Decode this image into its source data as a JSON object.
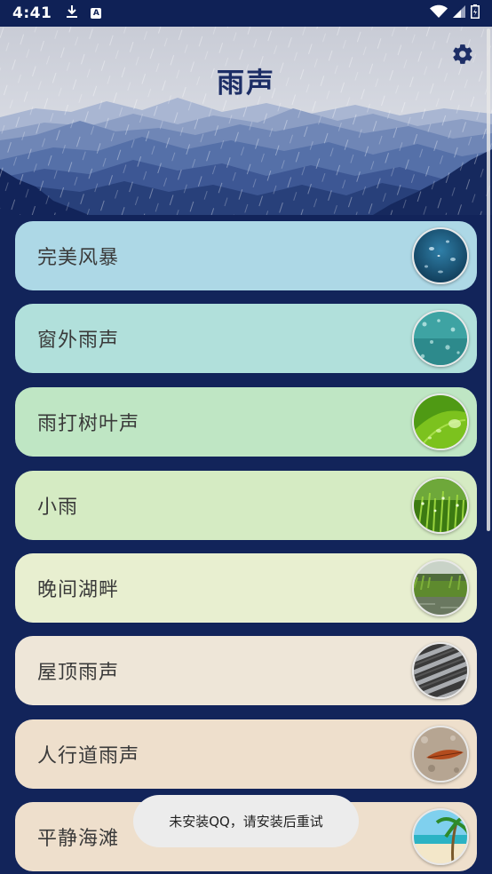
{
  "status_bar": {
    "time": "4:41"
  },
  "header": {
    "title": "雨声"
  },
  "cards": [
    {
      "label": "完美风暴",
      "color": "#add8e6",
      "thumb": "water-drops-blue"
    },
    {
      "label": "窗外雨声",
      "color": "#b1e0db",
      "thumb": "window-rain-teal"
    },
    {
      "label": "雨打树叶声",
      "color": "#bfe6c4",
      "thumb": "leaf-drops-green"
    },
    {
      "label": "小雨",
      "color": "#d5ebc3",
      "thumb": "grass-drops"
    },
    {
      "label": "晚间湖畔",
      "color": "#e8efd0",
      "thumb": "lake-reeds"
    },
    {
      "label": "屋顶雨声",
      "color": "#eee6d8",
      "thumb": "roof-tiles"
    },
    {
      "label": "人行道雨声",
      "color": "#eedfcc",
      "thumb": "pavement-leaf"
    },
    {
      "label": "平静海滩",
      "color": "#eedfcc",
      "thumb": "beach-palm"
    }
  ],
  "toast": {
    "message": "未安装QQ，请安装后重试"
  },
  "colors": {
    "background": "#12245a",
    "title": "#1d2e66"
  }
}
